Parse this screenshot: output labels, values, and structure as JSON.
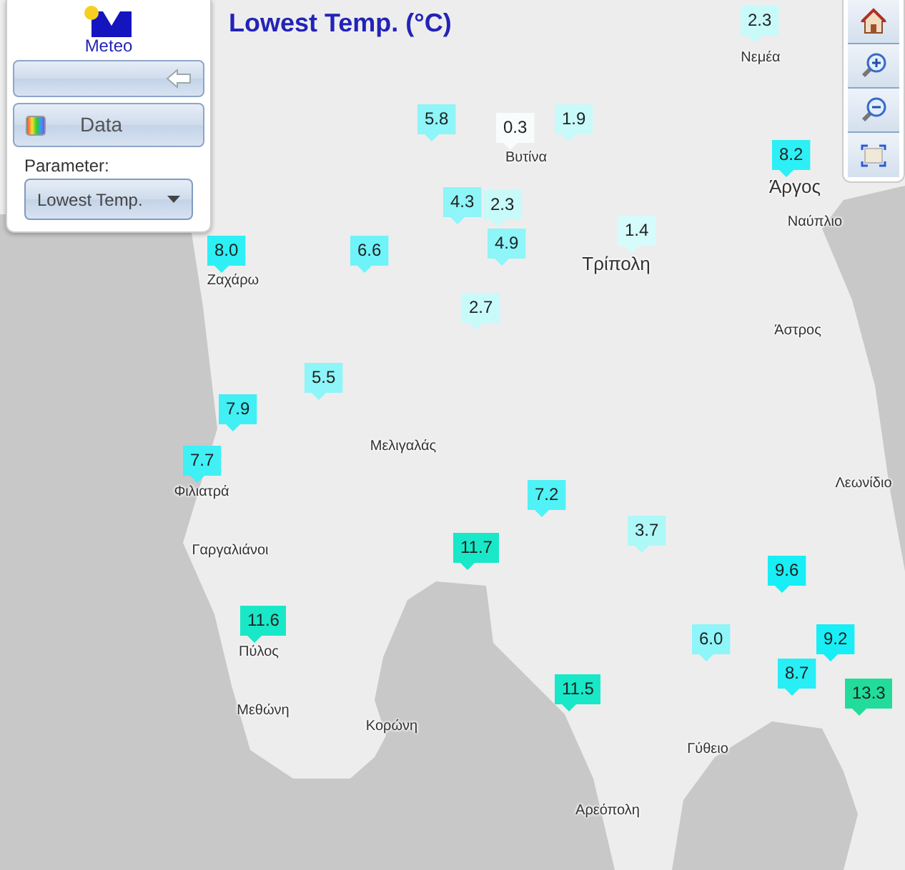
{
  "logo": {
    "text": "Meteo"
  },
  "title": "Lowest Temp. (°C)",
  "panel": {
    "section_label": "Data",
    "parameter_label": "Parameter:",
    "parameter_value": "Lowest Temp."
  },
  "places": [
    {
      "name": "Νεμέα",
      "kind": "town"
    },
    {
      "name": "Βυτίνα",
      "kind": "town"
    },
    {
      "name": "Άργος",
      "kind": "city"
    },
    {
      "name": "Ναύπλιο",
      "kind": "town"
    },
    {
      "name": "Τρίπολη",
      "kind": "city"
    },
    {
      "name": "Ζαχάρω",
      "kind": "town"
    },
    {
      "name": "Άστρος",
      "kind": "town"
    },
    {
      "name": "Μελιγαλάς",
      "kind": "town"
    },
    {
      "name": "Φιλιατρά",
      "kind": "town"
    },
    {
      "name": "Γαργαλιάνοι",
      "kind": "town"
    },
    {
      "name": "Λεωνίδιο",
      "kind": "town"
    },
    {
      "name": "Πύλος",
      "kind": "town"
    },
    {
      "name": "Μεθώνη",
      "kind": "town"
    },
    {
      "name": "Κορώνη",
      "kind": "town"
    },
    {
      "name": "Γύθειο",
      "kind": "town"
    },
    {
      "name": "Αρεόπολη",
      "kind": "town"
    }
  ],
  "stations": [
    {
      "value": "2.3",
      "color": "#c8fafa"
    },
    {
      "value": "5.8",
      "color": "#8ef5f8"
    },
    {
      "value": "0.3",
      "color": "#f8fcfc"
    },
    {
      "value": "1.9",
      "color": "#c8fafa"
    },
    {
      "value": "8.2",
      "color": "#2cf0f5"
    },
    {
      "value": "4.3",
      "color": "#8ef5f8"
    },
    {
      "value": "2.3",
      "color": "#c8fafa"
    },
    {
      "value": "4.9",
      "color": "#8ef5f8"
    },
    {
      "value": "1.4",
      "color": "#d6fbfb"
    },
    {
      "value": "8.0",
      "color": "#2cf0f5"
    },
    {
      "value": "6.6",
      "color": "#6ef4f8"
    },
    {
      "value": "2.7",
      "color": "#c8fafa"
    },
    {
      "value": "5.5",
      "color": "#8ef5f8"
    },
    {
      "value": "7.9",
      "color": "#40f0f5"
    },
    {
      "value": "7.7",
      "color": "#40f0f5"
    },
    {
      "value": "7.2",
      "color": "#50f2f6"
    },
    {
      "value": "3.7",
      "color": "#aef8f8"
    },
    {
      "value": "11.7",
      "color": "#18e8c8"
    },
    {
      "value": "9.6",
      "color": "#18eef5"
    },
    {
      "value": "6.0",
      "color": "#8ef5f8"
    },
    {
      "value": "9.2",
      "color": "#18eef5"
    },
    {
      "value": "8.7",
      "color": "#28eef5"
    },
    {
      "value": "11.6",
      "color": "#18e8c8"
    },
    {
      "value": "11.5",
      "color": "#18e8c8"
    },
    {
      "value": "13.3",
      "color": "#22dc9c"
    }
  ]
}
